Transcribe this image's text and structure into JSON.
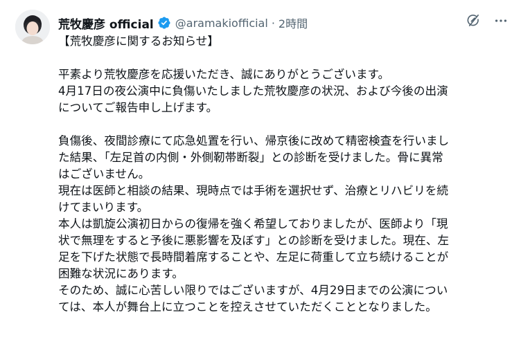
{
  "author": {
    "display_name": "荒牧慶彦 official",
    "handle": "@aramakiofficial",
    "separator": "·",
    "time": "2時間"
  },
  "icons": {
    "avatar": "avatar",
    "verified": "verified-badge-icon",
    "grok": "grok-icon",
    "more": "more-icon"
  },
  "colors": {
    "verified": "#1d9bf0",
    "text": "#0f1419",
    "secondary": "#536471"
  },
  "post": {
    "lines": [
      "【荒牧慶彦に関するお知らせ】",
      "",
      "平素より荒牧慶彦を応援いただき、誠にありがとうございます。",
      "4月17日の夜公演中に負傷いたしました荒牧慶彦の状況、および今後の出演",
      "についてご報告申し上げます。",
      "",
      "負傷後、夜間診療にて応急処置を行い、帰京後に改めて精密検査を行いまし",
      "た結果、「左足首の内側・外側靭帯断裂」との診断を受けました。骨に異常",
      "はございません。",
      "現在は医師と相談の結果、現時点では手術を選択せず、治療とリハビリを続",
      "けてまいります。",
      "本人は凱旋公演初日からの復帰を強く希望しておりましたが、医師より「現",
      "状で無理をすると予後に悪影響を及ぼす」との診断を受けました。現在、左",
      "足を下げた状態で長時間着席することや、左足に荷重して立ち続けることが",
      "困難な状況にあります。",
      "そのため、誠に心苦しい限りではございますが、4月29日までの公演につい",
      "ては、本人が舞台上に立つことを控えさせていただくこととなりました。"
    ]
  }
}
